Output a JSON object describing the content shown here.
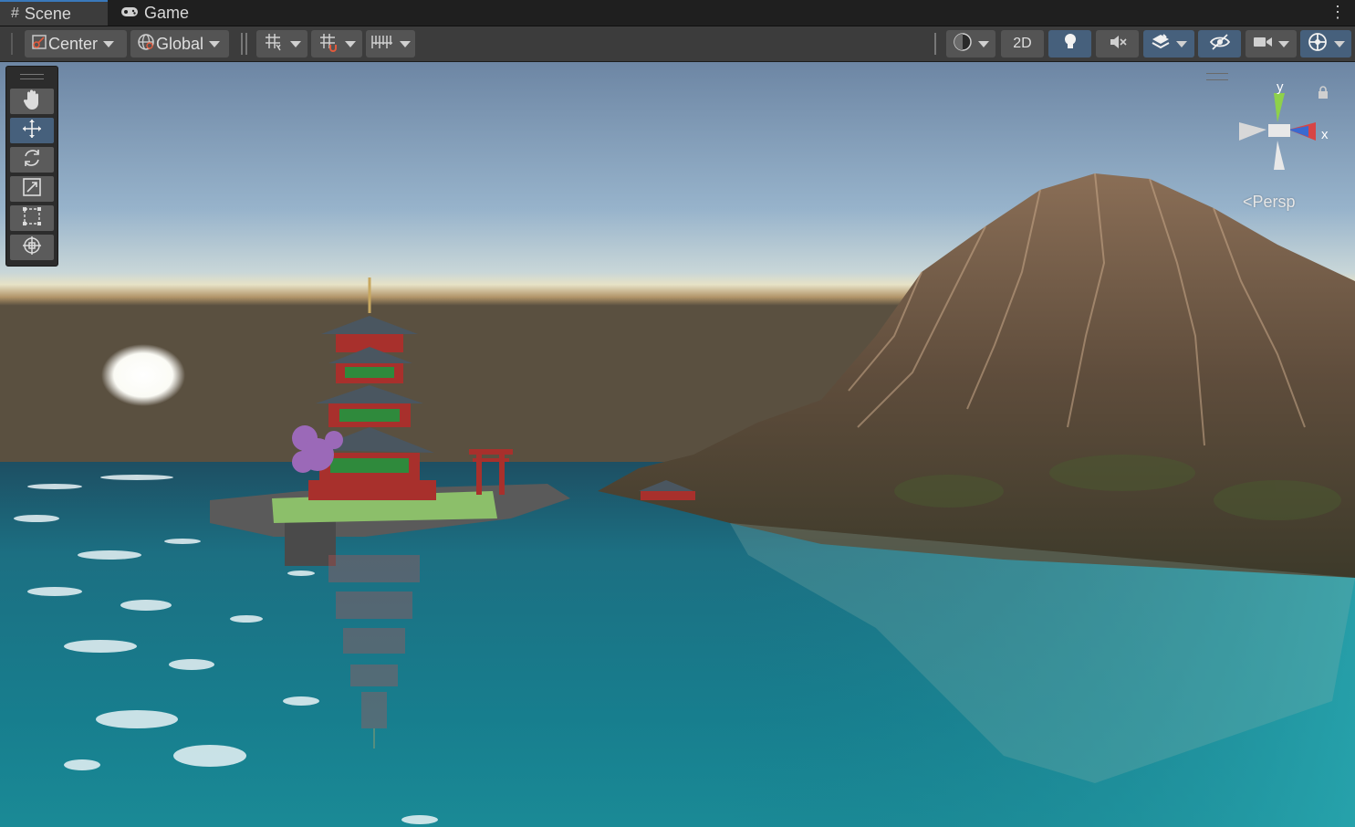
{
  "tabs": [
    {
      "label": "Scene",
      "icon": "grid-hash-icon",
      "active": true
    },
    {
      "label": "Game",
      "icon": "gamepad-icon",
      "active": false
    }
  ],
  "toolbar": {
    "pivot_mode": "Center",
    "pivot_rotation": "Global",
    "two_d_label": "2D"
  },
  "tools": [
    {
      "name": "hand-tool",
      "icon": "hand-icon"
    },
    {
      "name": "move-tool",
      "icon": "move-icon",
      "active": true
    },
    {
      "name": "rotate-tool",
      "icon": "rotate-icon"
    },
    {
      "name": "scale-tool",
      "icon": "scale-icon"
    },
    {
      "name": "rect-tool",
      "icon": "rect-icon"
    },
    {
      "name": "transform-tool",
      "icon": "transform-icon"
    }
  ],
  "gizmo": {
    "y_label": "y",
    "x_label": "x",
    "projection": "Persp"
  },
  "colors": {
    "accent_blue": "#46607c",
    "tab_highlight": "#3a79bb",
    "sky_top": "#6f88a6",
    "water": "#1a7e8c"
  }
}
